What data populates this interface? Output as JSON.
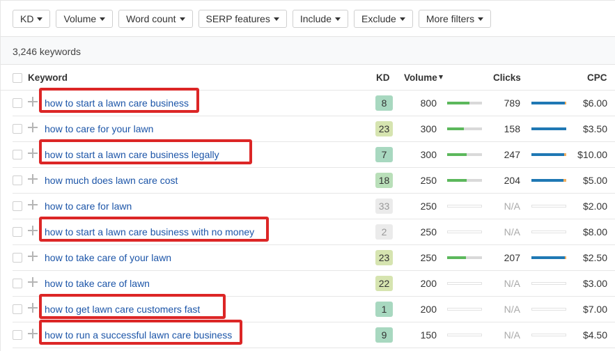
{
  "filters": [
    {
      "label": "KD"
    },
    {
      "label": "Volume"
    },
    {
      "label": "Word count"
    },
    {
      "label": "SERP features"
    },
    {
      "label": "Include"
    },
    {
      "label": "Exclude"
    },
    {
      "label": "More filters"
    }
  ],
  "keyword_count": "3,246 keywords",
  "table": {
    "headers": {
      "keyword": "Keyword",
      "kd": "KD",
      "volume": "Volume",
      "clicks": "Clicks",
      "cpc": "CPC"
    },
    "sort": {
      "column": "volume",
      "direction": "desc"
    },
    "colors": {
      "kd_green": "#a8d8c0",
      "kd_lightgreen": "#b9dfb9",
      "kd_yellowgreen": "#d6e4b0",
      "kd_gray": "#ebebeb",
      "volume_bar": "#5cb85c",
      "clicks_bar": "#1f78b4",
      "paid_clicks_bar": "#f0ad5e",
      "keyword_link": "#1c55a8",
      "highlight_box": "#dc2626"
    },
    "rows": [
      {
        "keyword": "how to start a lawn care business",
        "highlighted": true,
        "kd": "8",
        "kd_color": "#a8d8c0",
        "volume": "800",
        "volume_fill": 0.64,
        "clicks": "789",
        "clicks_fill": 0.96,
        "cpc": "$6.00"
      },
      {
        "keyword": "how to care for your lawn",
        "highlighted": false,
        "kd": "23",
        "kd_color": "#d6e4b0",
        "volume": "300",
        "volume_fill": 0.48,
        "clicks": "158",
        "clicks_fill": 1.0,
        "cpc": "$3.50"
      },
      {
        "keyword": "how to start a lawn care business legally",
        "highlighted": true,
        "kd": "7",
        "kd_color": "#a8d8c0",
        "volume": "300",
        "volume_fill": 0.56,
        "clicks": "247",
        "clicks_fill": 0.94,
        "cpc": "$10.00"
      },
      {
        "keyword": "how much does lawn care cost",
        "highlighted": false,
        "kd": "18",
        "kd_color": "#b9dfb9",
        "volume": "250",
        "volume_fill": 0.56,
        "clicks": "204",
        "clicks_fill": 0.92,
        "cpc": "$5.00"
      },
      {
        "keyword": "how to care for lawn",
        "highlighted": false,
        "kd": "33",
        "kd_color": "#ebebeb",
        "kd_muted": true,
        "volume": "250",
        "volume_fill": null,
        "clicks": "N/A",
        "clicks_fill": null,
        "cpc": "$2.00"
      },
      {
        "keyword": "how to start a lawn care business with no money",
        "highlighted": true,
        "kd": "2",
        "kd_color": "#ebebeb",
        "kd_muted": true,
        "volume": "250",
        "volume_fill": null,
        "clicks": "N/A",
        "clicks_fill": null,
        "cpc": "$8.00"
      },
      {
        "keyword": "how to take care of your lawn",
        "highlighted": false,
        "kd": "23",
        "kd_color": "#d6e4b0",
        "volume": "250",
        "volume_fill": 0.54,
        "clicks": "207",
        "clicks_fill": 0.96,
        "cpc": "$2.50"
      },
      {
        "keyword": "how to take care of lawn",
        "highlighted": false,
        "kd": "22",
        "kd_color": "#d6e4b0",
        "volume": "200",
        "volume_fill": null,
        "clicks": "N/A",
        "clicks_fill": null,
        "cpc": "$3.00"
      },
      {
        "keyword": "how to get lawn care customers fast",
        "highlighted": true,
        "kd": "1",
        "kd_color": "#a8d8c0",
        "volume": "200",
        "volume_fill": null,
        "clicks": "N/A",
        "clicks_fill": null,
        "cpc": "$7.00"
      },
      {
        "keyword": "how to run a successful lawn care business",
        "highlighted": true,
        "kd": "9",
        "kd_color": "#a8d8c0",
        "volume": "150",
        "volume_fill": null,
        "clicks": "N/A",
        "clicks_fill": null,
        "cpc": "$4.50"
      }
    ]
  }
}
